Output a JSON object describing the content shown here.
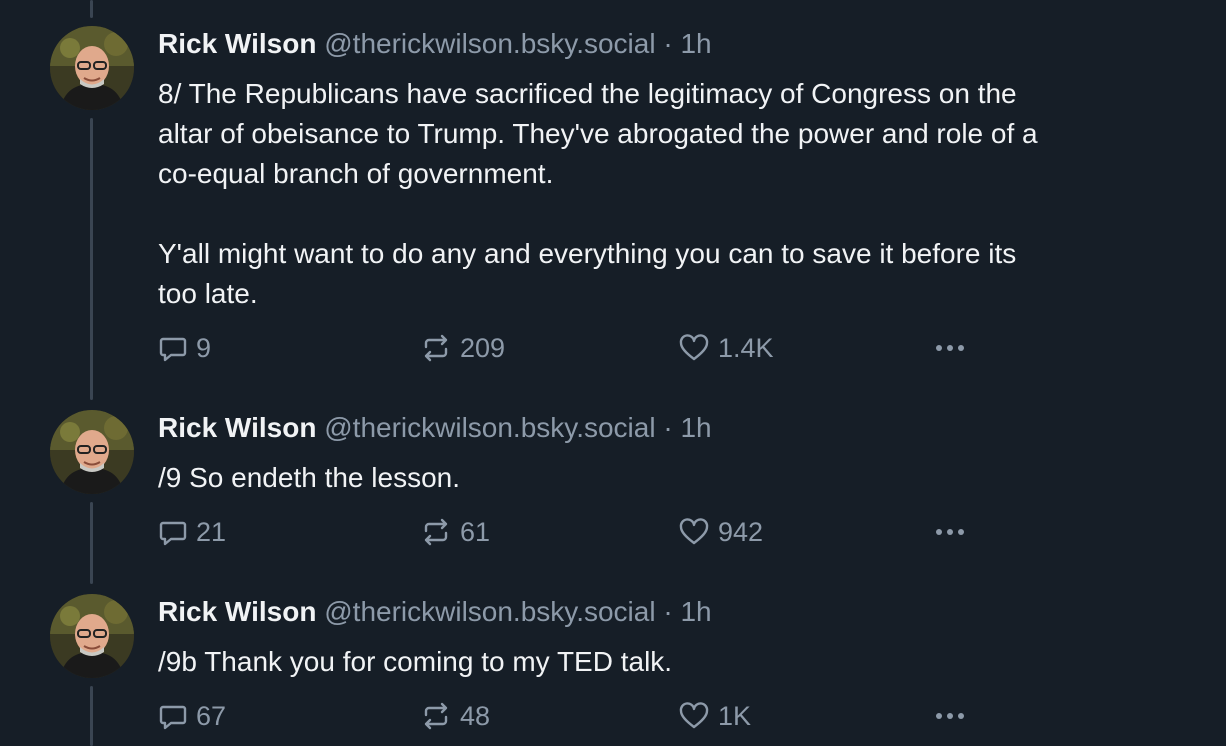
{
  "posts": [
    {
      "author": "Rick Wilson",
      "handle": "@therickwilson.bsky.social",
      "separator": "·",
      "time": "1h",
      "text": "8/ The Republicans have sacrificed the legitimacy of Congress on the\naltar of obeisance to Trump. They've abrogated the power and role of a\nco-equal branch of government.\n\nY'all might want to do any and everything you can to save it before its\ntoo late.",
      "replies": "9",
      "reposts": "209",
      "likes": "1.4K"
    },
    {
      "author": "Rick Wilson",
      "handle": "@therickwilson.bsky.social",
      "separator": "·",
      "time": "1h",
      "text": "/9 So endeth the lesson.",
      "replies": "21",
      "reposts": "61",
      "likes": "942"
    },
    {
      "author": "Rick Wilson",
      "handle": "@therickwilson.bsky.social",
      "separator": "·",
      "time": "1h",
      "text": "/9b Thank you for coming to my TED talk.",
      "replies": "67",
      "reposts": "48",
      "likes": "1K"
    }
  ],
  "icons": {
    "reply": "reply-icon",
    "repost": "repost-icon",
    "like": "heart-icon",
    "more": "more-options-icon"
  },
  "colors": {
    "background": "#161e27",
    "text": "#f1f3f5",
    "muted": "#8d9aa9",
    "thread_line": "#3a4552"
  }
}
